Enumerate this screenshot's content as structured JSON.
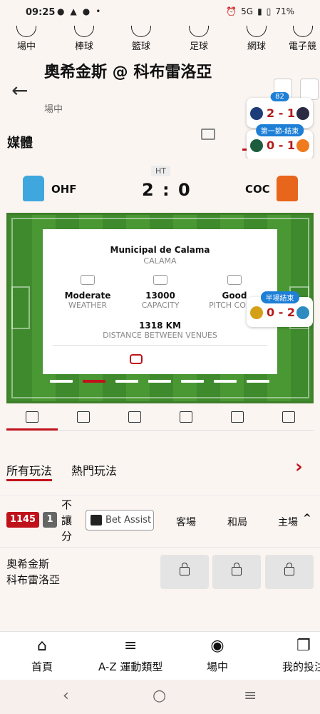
{
  "status_bar": {
    "time": "09:25",
    "network": "5G",
    "battery": "71%"
  },
  "sports_nav": [
    {
      "label": "場中",
      "icon": "live-icon"
    },
    {
      "label": "棒球",
      "icon": "baseball-icon"
    },
    {
      "label": "籃球",
      "icon": "basketball-icon"
    },
    {
      "label": "足球",
      "icon": "soccer-icon"
    },
    {
      "label": "網球",
      "icon": "tennis-icon"
    },
    {
      "label": "電子競",
      "icon": "esports-icon"
    }
  ],
  "header": {
    "title": "奧希金斯 @ 科布雷洛亞",
    "subtitle": "場中"
  },
  "overlays": [
    {
      "badge": "82",
      "score": "2 - 1"
    },
    {
      "badge": "第一節-結束",
      "score": "0 - 1"
    },
    {
      "badge": "半場結束",
      "score": "0 - 2"
    }
  ],
  "media": {
    "label": "媒體"
  },
  "scoreboard": {
    "period": "HT",
    "home": "OHF",
    "away": "COC",
    "score": "2 : 0"
  },
  "venue": {
    "name": "Municipal de Calama",
    "city": "CALAMA",
    "stats": [
      {
        "value": "Moderate",
        "label": "WEATHER"
      },
      {
        "value": "13000",
        "label": "CAPACITY"
      },
      {
        "value": "Good",
        "label": "PITCH CONDI"
      }
    ],
    "distance_value": "1318 KM",
    "distance_label": "DISTANCE BETWEEN VENUES"
  },
  "market_tabs": [
    "所有玩法",
    "熱門玩法"
  ],
  "odds": {
    "id": "1145",
    "count": "1",
    "handicap_label": "不讓分",
    "bet_assist": "Bet Assist",
    "columns": [
      "客場",
      "和局",
      "主場"
    ]
  },
  "match": {
    "team1": "奧希金斯",
    "team2": "科布雷洛亞"
  },
  "bottom_nav": [
    {
      "label": "首頁",
      "icon": "home-icon"
    },
    {
      "label": "A-Z 運動類型",
      "icon": "menu-icon"
    },
    {
      "label": "場中",
      "icon": "live-icon"
    },
    {
      "label": "我的投注",
      "icon": "bets-icon"
    }
  ]
}
